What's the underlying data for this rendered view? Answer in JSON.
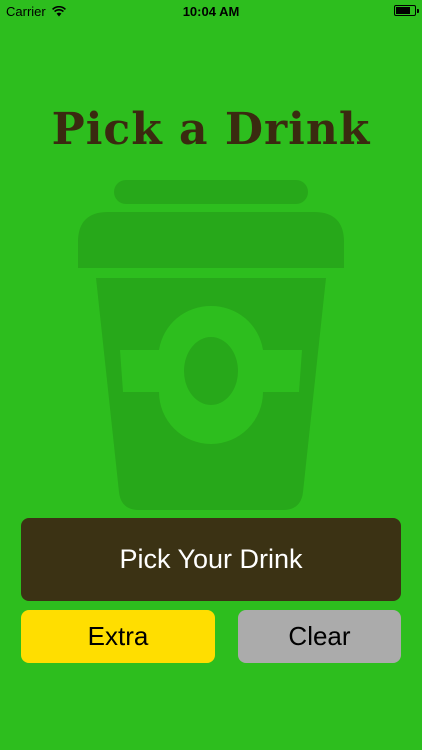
{
  "status_bar": {
    "carrier": "Carrier",
    "time": "10:04 AM"
  },
  "title": "Pick a Drink",
  "buttons": {
    "pick": "Pick Your Drink",
    "extra": "Extra",
    "clear": "Clear"
  },
  "colors": {
    "background": "#2DBE1E",
    "cup": "#27A81A",
    "title": "#3A2A10",
    "pick_button": "#3B3214",
    "extra_button": "#FFDE00",
    "clear_button": "#ABABAB"
  },
  "icons": {
    "cup": "coffee-cup-icon",
    "wifi": "wifi-icon",
    "battery": "battery-icon"
  }
}
